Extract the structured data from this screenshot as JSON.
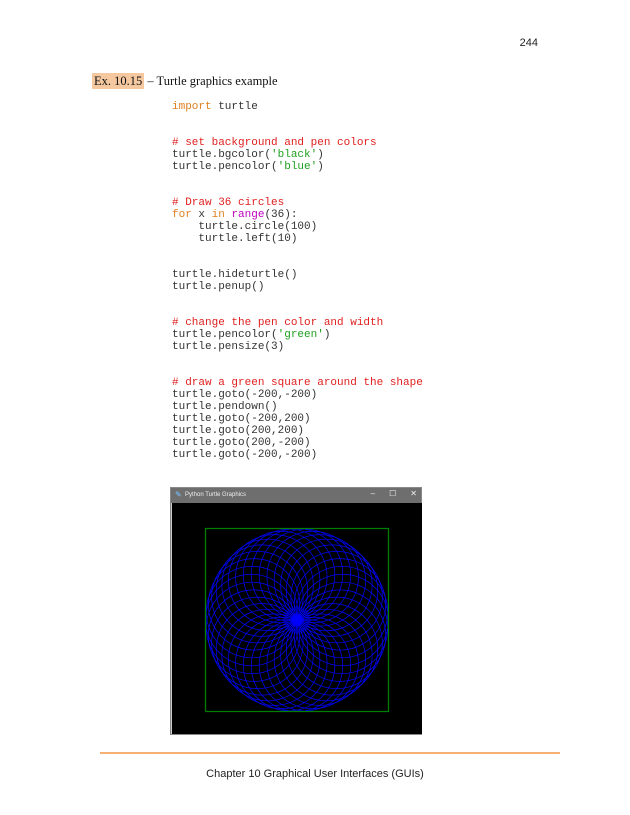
{
  "page": {
    "number": "244"
  },
  "heading": {
    "label": "Ex. 10.15",
    "text": " – Turtle graphics example"
  },
  "code": [
    [
      [
        "kw",
        "import"
      ],
      [
        "p",
        " turtle"
      ]
    ],
    [],
    [],
    [
      [
        "cm",
        "# set background and pen colors"
      ]
    ],
    [
      [
        "p",
        "turtle.bgcolor("
      ],
      [
        "str",
        "'black'"
      ],
      [
        "p",
        ")"
      ]
    ],
    [
      [
        "p",
        "turtle.pencolor("
      ],
      [
        "str",
        "'blue'"
      ],
      [
        "p",
        ")"
      ]
    ],
    [],
    [],
    [
      [
        "cm",
        "# Draw 36 circles"
      ]
    ],
    [
      [
        "kw",
        "for"
      ],
      [
        "p",
        " x "
      ],
      [
        "kw",
        "in"
      ],
      [
        "p",
        " "
      ],
      [
        "fn",
        "range"
      ],
      [
        "p",
        "(36):"
      ]
    ],
    [
      [
        "p",
        "    turtle.circle(100)"
      ]
    ],
    [
      [
        "p",
        "    turtle.left(10)"
      ]
    ],
    [],
    [],
    [
      [
        "p",
        "turtle.hideturtle()"
      ]
    ],
    [
      [
        "p",
        "turtle.penup()"
      ]
    ],
    [],
    [],
    [
      [
        "cm",
        "# change the pen color and width"
      ]
    ],
    [
      [
        "p",
        "turtle.pencolor("
      ],
      [
        "str",
        "'green'"
      ],
      [
        "p",
        ")"
      ]
    ],
    [
      [
        "p",
        "turtle.pensize(3)"
      ]
    ],
    [],
    [],
    [
      [
        "cm",
        "# draw a green square around the shape"
      ]
    ],
    [
      [
        "p",
        "turtle.goto(-200,-200)"
      ]
    ],
    [
      [
        "p",
        "turtle.pendown()"
      ]
    ],
    [
      [
        "p",
        "turtle.goto(-200,200)"
      ]
    ],
    [
      [
        "p",
        "turtle.goto(200,200)"
      ]
    ],
    [
      [
        "p",
        "turtle.goto(200,-200)"
      ]
    ],
    [
      [
        "p",
        "turtle.goto(-200,-200)"
      ]
    ]
  ],
  "turtle_window": {
    "title": "Python Turtle Graphics",
    "minimize": "–",
    "maximize": "☐",
    "close": "✕",
    "colors": {
      "background": "#000000",
      "circles": "#0000ff",
      "square": "#008000"
    },
    "drawing": {
      "circle_count": 36,
      "radius": 100,
      "turn_degrees": 10,
      "square_corners": [
        [
          -200,
          -200
        ],
        [
          -200,
          200
        ],
        [
          200,
          200
        ],
        [
          200,
          -200
        ]
      ]
    }
  },
  "footer": {
    "text": "Chapter 10 Graphical User Interfaces (GUIs)",
    "rule_color": "#f08020"
  }
}
